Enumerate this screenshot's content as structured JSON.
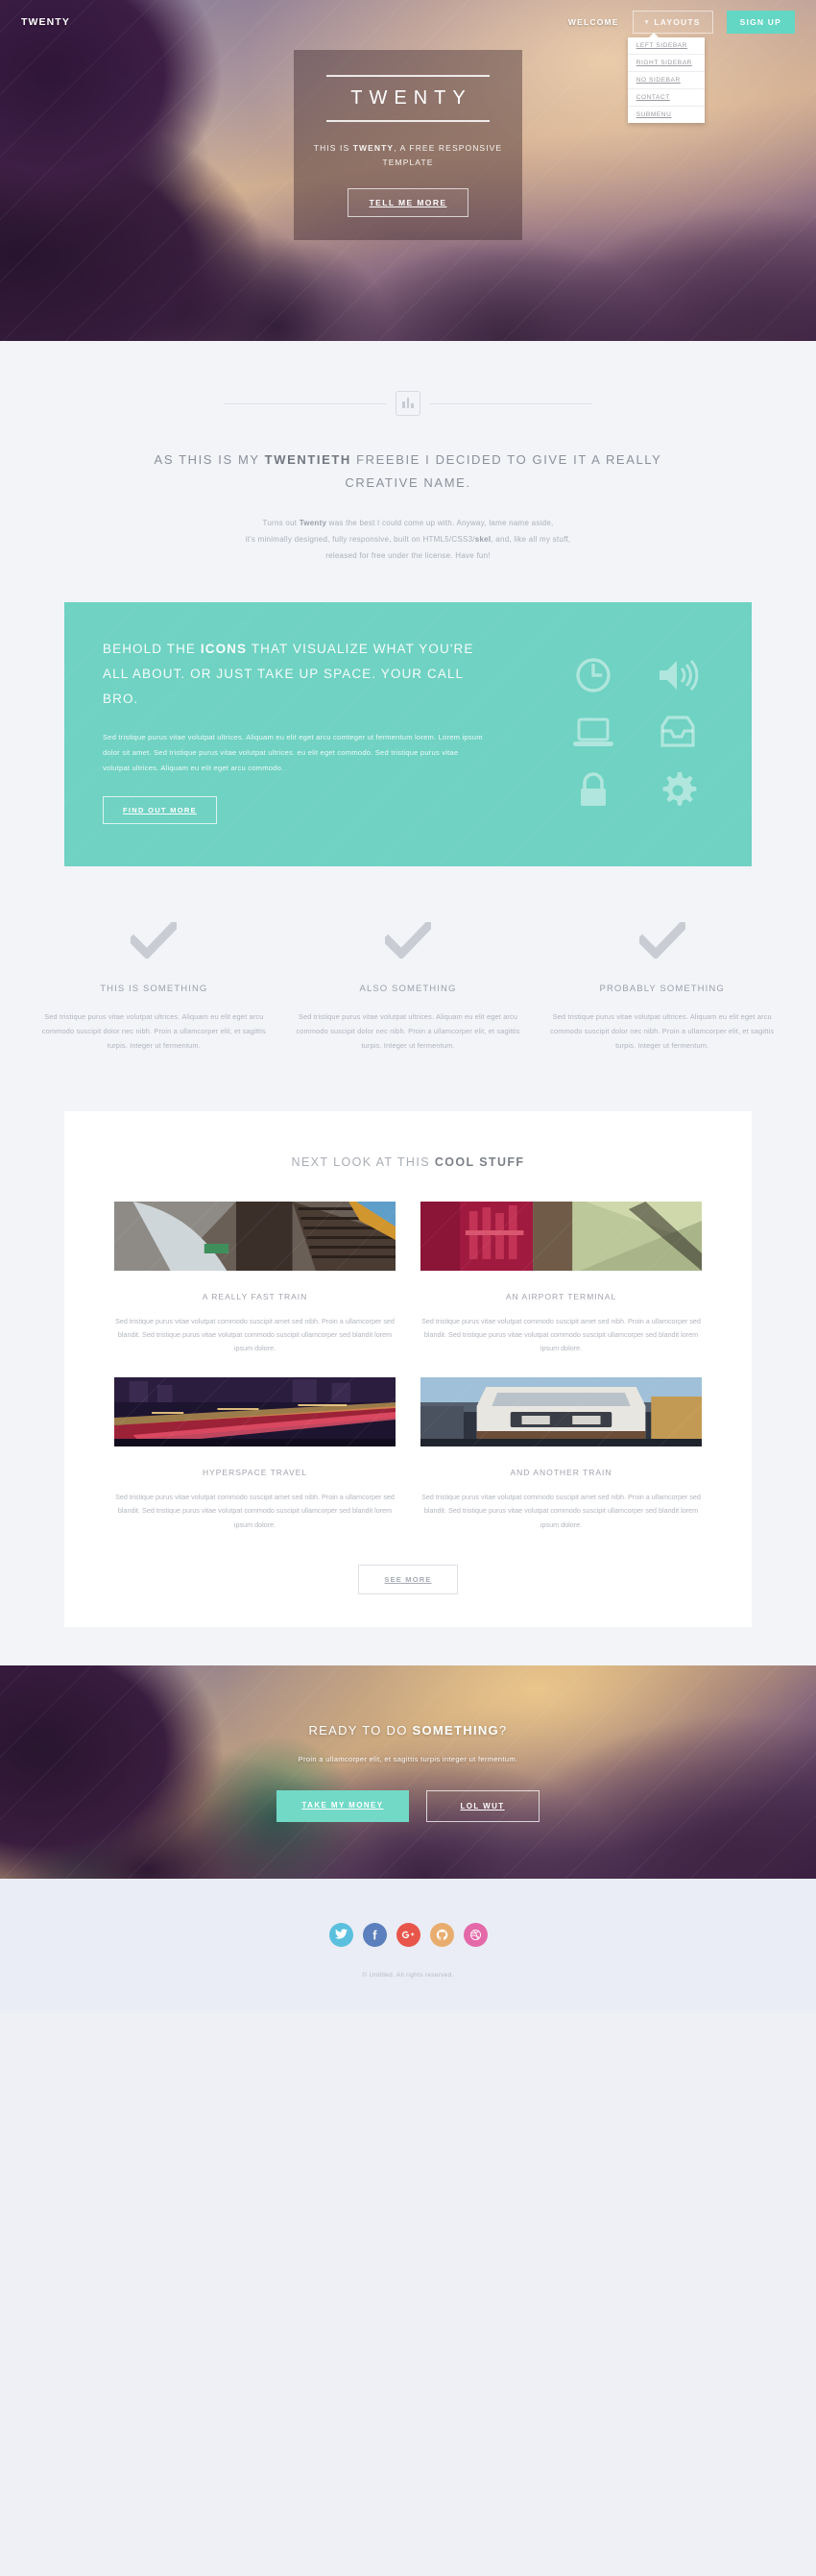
{
  "colors": {
    "accent_teal": "#6fd2c2",
    "signup_teal": "#63d6c4",
    "page_bg": "#f2f4f8",
    "footer_bg": "#eaedf5",
    "muted_text": "#a9adb5"
  },
  "header": {
    "logo": "TWENTY",
    "nav": {
      "welcome_label": "WELCOME",
      "layouts_label": "LAYOUTS",
      "signup_label": "SIGN UP",
      "dropdown_items": [
        {
          "label": "LEFT SIDEBAR"
        },
        {
          "label": "RIGHT SIDEBAR"
        },
        {
          "label": "NO SIDEBAR"
        },
        {
          "label": "CONTACT"
        },
        {
          "label": "SUBMENU"
        }
      ]
    }
  },
  "hero": {
    "title": "TWENTY",
    "subtitle_prefix": "THIS IS ",
    "subtitle_bold": "TWENTY",
    "subtitle_suffix": ", A FREE RESPONSIVE TEMPLATE",
    "cta_label": "TELL ME MORE"
  },
  "intro": {
    "icon": "bar-chart-icon",
    "heading_part1": "AS THIS IS MY ",
    "heading_bold": "TWENTIETH",
    "heading_part2": " FREEBIE I DECIDED TO GIVE IT A REALLY CREATIVE NAME.",
    "body_line1_pre": "Turns out ",
    "body_line1_bold": "Twenty",
    "body_line1_post": " was the best I could come up with. Anyway, lame name aside,",
    "body_line2_pre": "it's minimally designed, fully responsive, built on HTML5/CSS3/",
    "body_line2_bold": "skel",
    "body_line2_post": ", and, like all my stuff,",
    "body_line3": "released for free under the license. Have fun!"
  },
  "icons_section": {
    "heading_pre": "BEHOLD THE ",
    "heading_bold": "ICONS",
    "heading_post": " THAT VISUALIZE WHAT YOU'RE ALL ABOUT. OR JUST TAKE UP SPACE. YOUR CALL BRO.",
    "body": "Sed tristique purus vitae volutpat ultrices. Aliquam eu elit eget arcu comteger ut fermentum lorem. Lorem ipsum dolor sit amet. Sed tristique purus vitae volutpat ultrices. eu elit eget commodo. Sed tristique purus vitae volutpat ultrices. Aliquam eu elit eget arcu commodo.",
    "button_label": "FIND OUT MORE",
    "icon_names": [
      "clock-icon",
      "volume-icon",
      "laptop-icon",
      "inbox-icon",
      "lock-icon",
      "gear-icon"
    ]
  },
  "features": [
    {
      "icon": "check-icon",
      "title": "THIS IS SOMETHING",
      "body": "Sed tristique purus vitae volutpat ultrices. Aliquam eu elit eget arcu commodo suscipit dolor nec nibh. Proin a ullamcorper elit, et sagittis turpis. Integer ut fermentum."
    },
    {
      "icon": "check-icon",
      "title": "ALSO SOMETHING",
      "body": "Sed tristique purus vitae volutpat ultrices. Aliquam eu elit eget arcu commodo suscipit dolor nec nibh. Proin a ullamcorper elit, et sagittis turpis. Integer ut fermentum."
    },
    {
      "icon": "check-icon",
      "title": "PROBABLY SOMETHING",
      "body": "Sed tristique purus vitae volutpat ultrices. Aliquam eu elit eget arcu commodo suscipit dolor nec nibh. Proin a ullamcorper elit, et sagittis turpis. Integer ut fermentum."
    }
  ],
  "cool_stuff": {
    "heading_pre": "NEXT LOOK AT THIS ",
    "heading_bold": "COOL STUFF",
    "items": [
      {
        "title": "A REALLY FAST TRAIN",
        "body": "Sed tristique purus vitae volutpat commodo suscipit amet sed nibh. Proin a ullamcorper sed blandit. Sed tristique purus vitae volutpat commodo suscipit ullamcorper sed blandit lorem ipsum dolore."
      },
      {
        "title": "AN AIRPORT TERMINAL",
        "body": "Sed tristique purus vitae volutpat commodo suscipit amet sed nibh. Proin a ullamcorper sed blandit. Sed tristique purus vitae volutpat commodo suscipit ullamcorper sed blandit lorem ipsum dolore."
      },
      {
        "title": "HYPERSPACE TRAVEL",
        "body": "Sed tristique purus vitae volutpat commodo suscipit amet sed nibh. Proin a ullamcorper sed blandit. Sed tristique purus vitae volutpat commodo suscipit ullamcorper sed blandit lorem ipsum dolore."
      },
      {
        "title": "AND ANOTHER TRAIN",
        "body": "Sed tristique purus vitae volutpat commodo suscipit amet sed nibh. Proin a ullamcorper sed blandit. Sed tristique purus vitae volutpat commodo suscipit ullamcorper sed blandit lorem ipsum dolore."
      }
    ],
    "see_more_label": "SEE MORE"
  },
  "cta": {
    "heading_pre": "READY TO DO ",
    "heading_bold": "SOMETHING",
    "heading_post": "?",
    "body": "Proin a ullamcorper elit, et sagittis turpis integer ut fermentum.",
    "primary_label": "TAKE MY MONEY",
    "secondary_label": "LOL WUT"
  },
  "footer": {
    "socials": [
      {
        "name": "twitter-icon",
        "color": "#5bc0de"
      },
      {
        "name": "facebook-icon",
        "color": "#5c7fbd"
      },
      {
        "name": "google-plus-icon",
        "color": "#e8564b"
      },
      {
        "name": "github-icon",
        "color": "#e8ad6e"
      },
      {
        "name": "dribbble-icon",
        "color": "#e469a8"
      }
    ],
    "copyright": "© Untitled. All rights reserved."
  }
}
